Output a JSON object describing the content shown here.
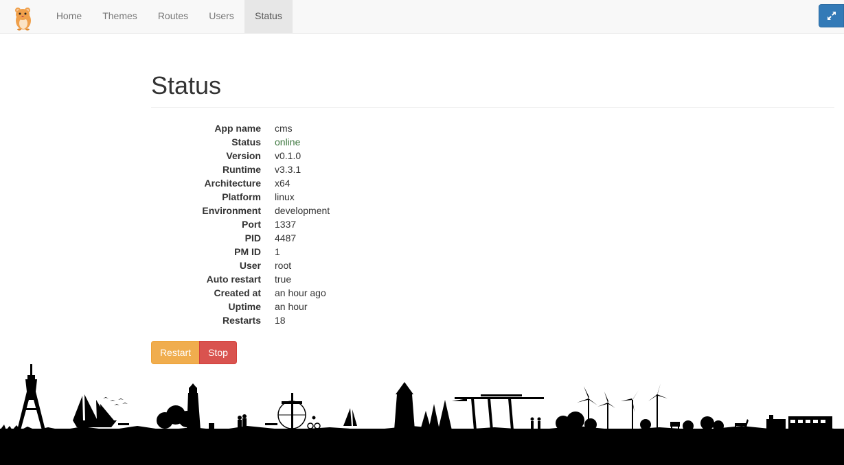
{
  "navbar": {
    "brand_icon": "hamster-logo-icon",
    "items": [
      {
        "label": "Home",
        "active": false
      },
      {
        "label": "Themes",
        "active": false
      },
      {
        "label": "Routes",
        "active": false
      },
      {
        "label": "Users",
        "active": false
      },
      {
        "label": "Status",
        "active": true
      }
    ],
    "fullscreen_icon": "expand-icon"
  },
  "page": {
    "title": "Status"
  },
  "info": [
    {
      "label": "App name",
      "value": "cms"
    },
    {
      "label": "Status",
      "value": "online"
    },
    {
      "label": "Version",
      "value": "v0.1.0"
    },
    {
      "label": "Runtime",
      "value": "v3.3.1"
    },
    {
      "label": "Architecture",
      "value": "x64"
    },
    {
      "label": "Platform",
      "value": "linux"
    },
    {
      "label": "Environment",
      "value": "development"
    },
    {
      "label": "Port",
      "value": "1337"
    },
    {
      "label": "PID",
      "value": "4487"
    },
    {
      "label": "PM ID",
      "value": "1"
    },
    {
      "label": "User",
      "value": "root"
    },
    {
      "label": "Auto restart",
      "value": "true"
    },
    {
      "label": "Created at",
      "value": "an hour ago"
    },
    {
      "label": "Uptime",
      "value": "an hour"
    },
    {
      "label": "Restarts",
      "value": "18"
    }
  ],
  "actions": {
    "restart_label": "Restart",
    "stop_label": "Stop"
  },
  "colors": {
    "online": "#3c763d",
    "restart": "#f0ad4e",
    "stop": "#d9534f",
    "primary": "#337ab7"
  }
}
